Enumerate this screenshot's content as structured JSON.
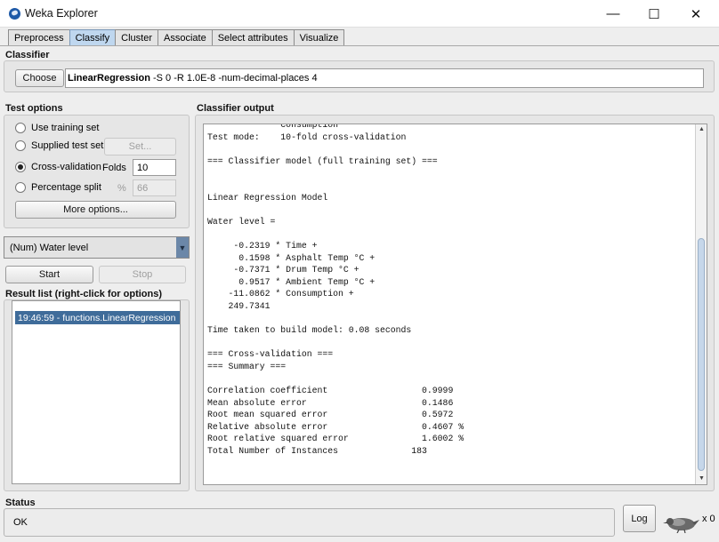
{
  "window": {
    "title": "Weka Explorer",
    "minimize_glyph": "—",
    "maximize_glyph": "☐",
    "close_glyph": "✕"
  },
  "tabs": [
    {
      "label": "Preprocess",
      "active": false
    },
    {
      "label": "Classify",
      "active": true
    },
    {
      "label": "Cluster",
      "active": false
    },
    {
      "label": "Associate",
      "active": false
    },
    {
      "label": "Select attributes",
      "active": false
    },
    {
      "label": "Visualize",
      "active": false
    }
  ],
  "classifier": {
    "section_label": "Classifier",
    "choose_label": "Choose",
    "name": "LinearRegression",
    "options": " -S 0 -R 1.0E-8 -num-decimal-places 4"
  },
  "test_options": {
    "section_label": "Test options",
    "use_training_set": "Use training set",
    "supplied_test_set": "Supplied test set",
    "set_button": "Set...",
    "cross_validation": "Cross-validation",
    "folds_label": "Folds",
    "folds_value": "10",
    "percentage_split": "Percentage split",
    "percent_symbol": "%",
    "percent_value": "66",
    "more_options": "More options...",
    "selected": "cross_validation"
  },
  "target": {
    "selected": "(Num) Water level"
  },
  "run": {
    "start_label": "Start",
    "stop_label": "Stop"
  },
  "result_list": {
    "section_label": "Result list (right-click for options)",
    "items": [
      "19:46:59 - functions.LinearRegression"
    ]
  },
  "output": {
    "section_label": "Classifier output",
    "lines": [
      "              Consumption",
      "Test mode:    10-fold cross-validation",
      "",
      "=== Classifier model (full training set) ===",
      "",
      "",
      "Linear Regression Model",
      "",
      "Water level =",
      "",
      "     -0.2319 * Time +",
      "      0.1598 * Asphalt Temp °C +",
      "     -0.7371 * Drum Temp °C +",
      "      0.9517 * Ambient Temp °C +",
      "    -11.0862 * Consumption +",
      "    249.7341",
      "",
      "Time taken to build model: 0.08 seconds",
      "",
      "=== Cross-validation ===",
      "=== Summary ===",
      "",
      "Correlation coefficient                  0.9999",
      "Mean absolute error                      0.1486",
      "Root mean squared error                  0.5972",
      "Relative absolute error                  0.4607 %",
      "Root relative squared error              1.6002 %",
      "Total Number of Instances              183"
    ]
  },
  "status": {
    "section_label": "Status",
    "text": "OK",
    "log_label": "Log",
    "count": "x 0"
  },
  "colors": {
    "selected_tab": "#bfd7ef",
    "selection": "#3f6c9a",
    "scroll_thumb": "#c6d7ea"
  }
}
